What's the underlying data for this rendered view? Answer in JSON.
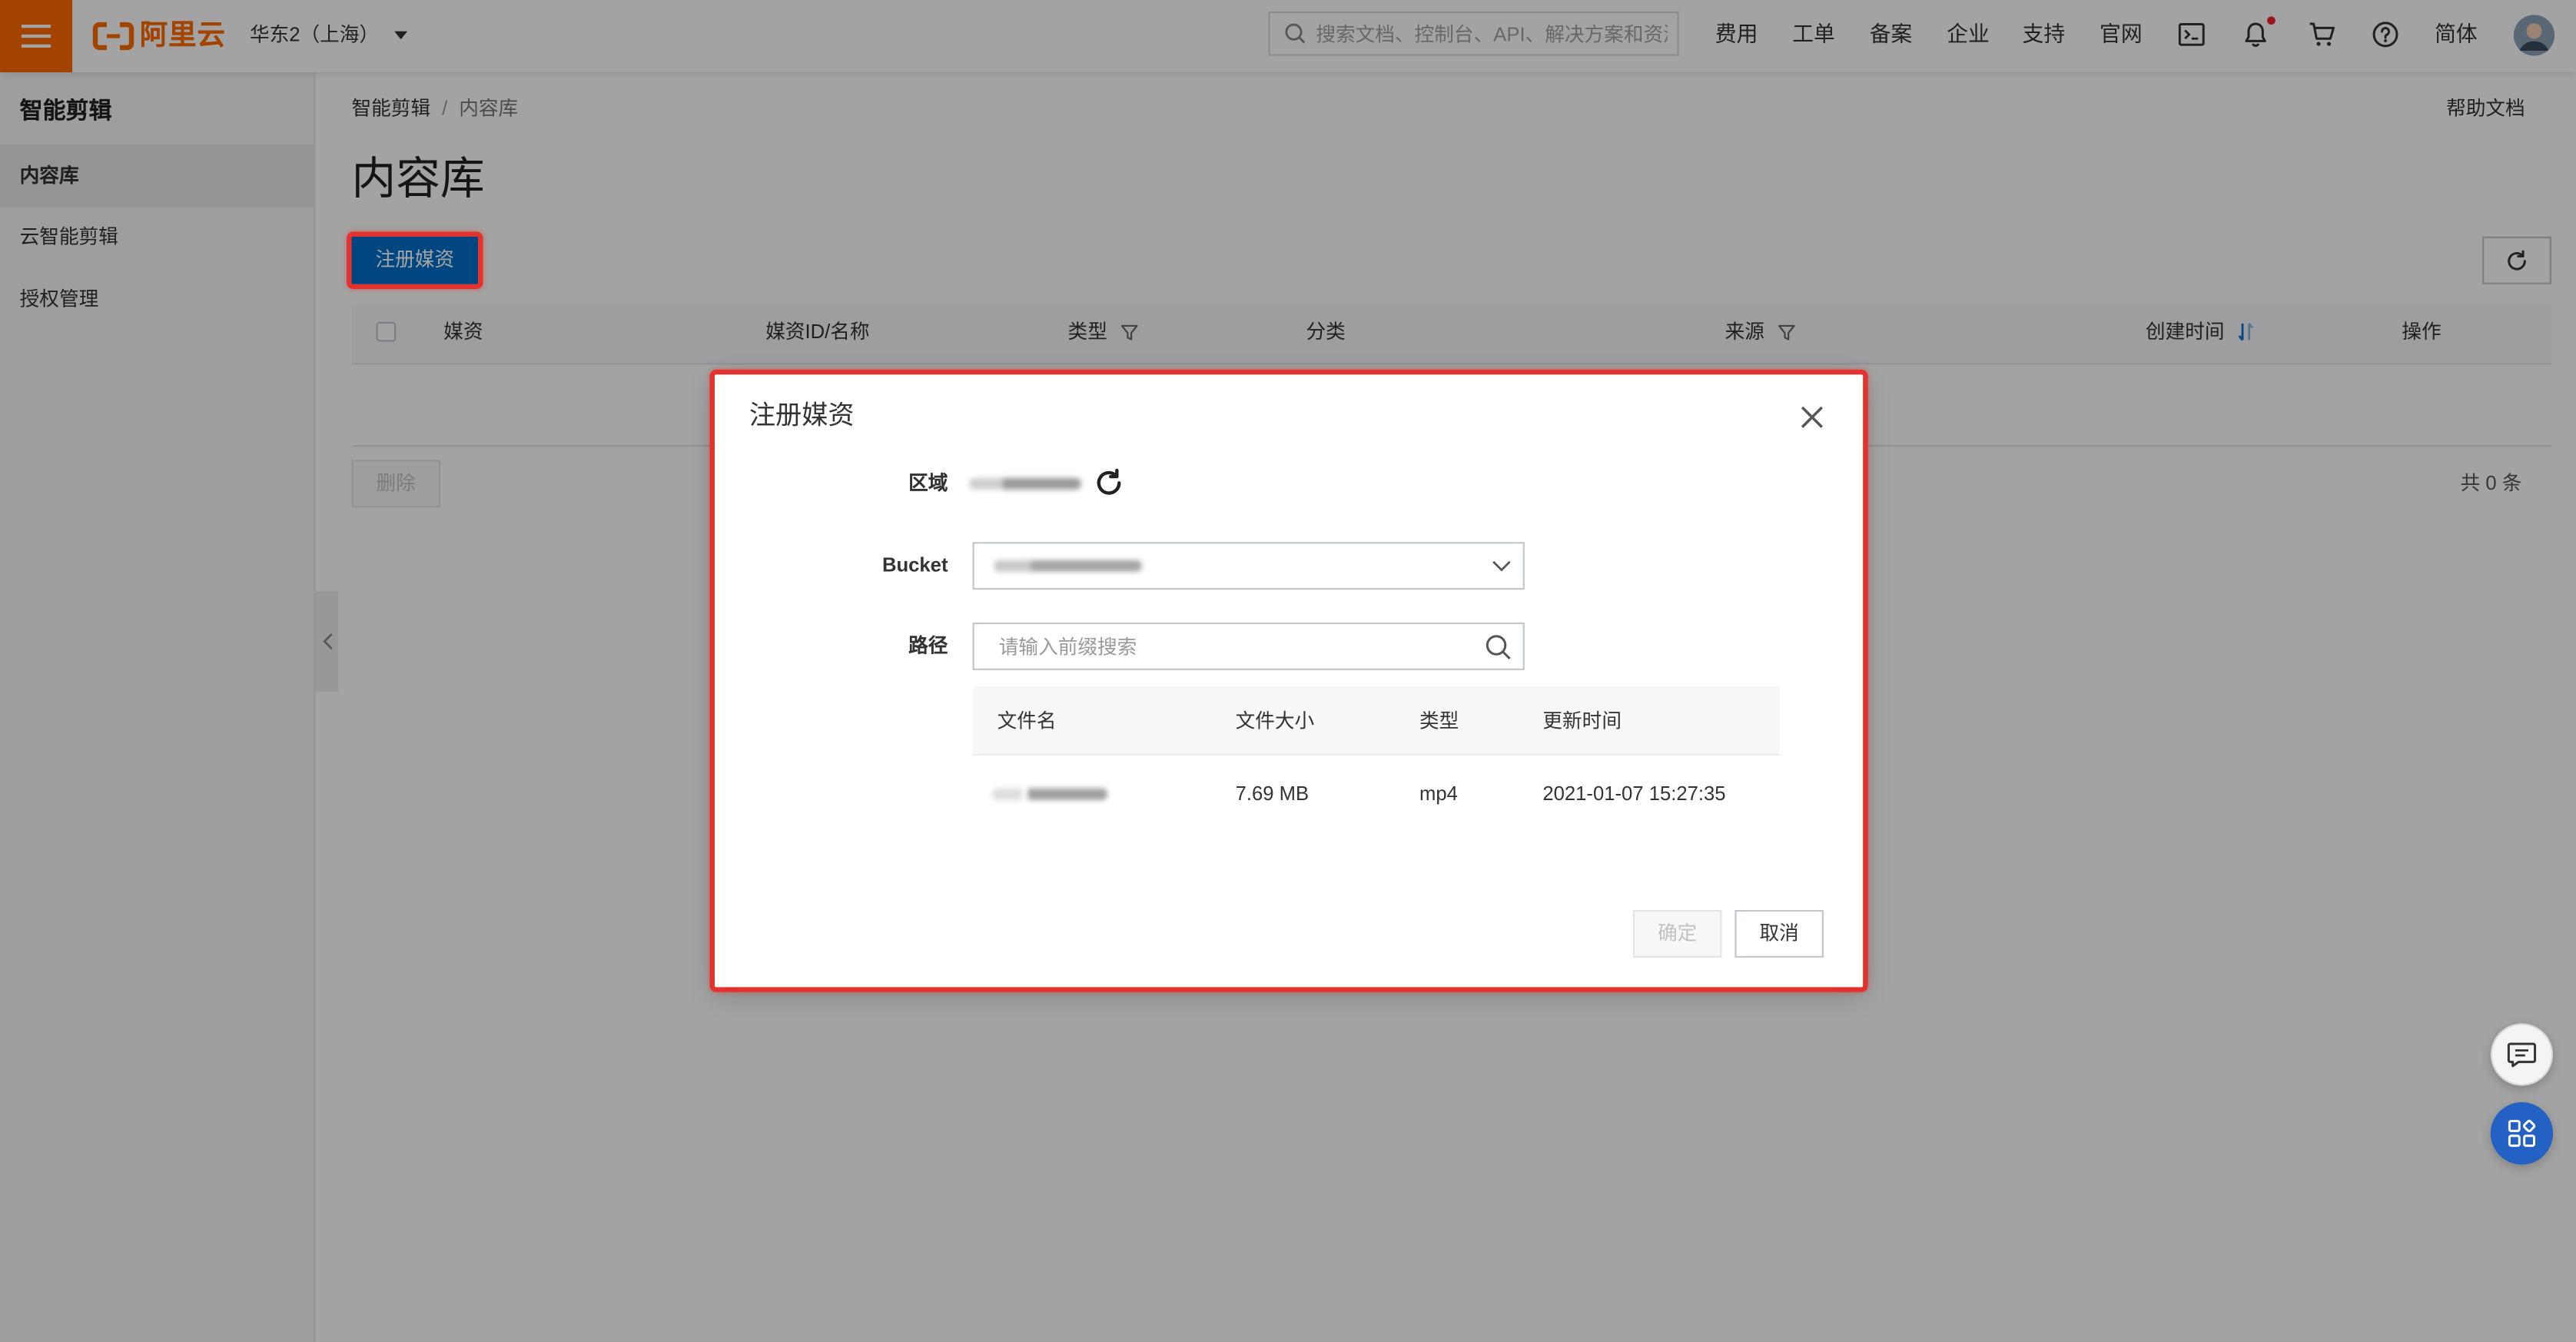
{
  "topbar": {
    "logo_text": "阿里云",
    "region": "华东2（上海）",
    "search_placeholder": "搜索文档、控制台、API、解决方案和资源",
    "nav": [
      "费用",
      "工单",
      "备案",
      "企业",
      "支持",
      "官网"
    ],
    "language": "简体",
    "icons": [
      "hamburger-menu-icon",
      "aliyun-logo-icon",
      "caret-down-icon",
      "search-icon",
      "terminal-icon",
      "bell-icon",
      "cart-icon",
      "help-icon",
      "avatar"
    ],
    "has_notification": true
  },
  "sidebar": {
    "title": "智能剪辑",
    "items": [
      {
        "label": "内容库",
        "active": true
      },
      {
        "label": "云智能剪辑",
        "active": false
      },
      {
        "label": "授权管理",
        "active": false
      }
    ]
  },
  "main": {
    "breadcrumb": [
      "智能剪辑",
      "内容库"
    ],
    "breadcrumb_separator": "/",
    "help_link": "帮助文档",
    "title": "内容库",
    "register_button": "注册媒资",
    "table": {
      "columns": [
        "媒资",
        "媒资ID/名称",
        "类型",
        "分类",
        "来源",
        "创建时间",
        "操作"
      ],
      "rows": []
    },
    "delete_button": "删除",
    "delete_enabled": false,
    "total": "共 0 条"
  },
  "dialog": {
    "title": "注册媒资",
    "region_label": "区域",
    "bucket_label": "Bucket",
    "path_label": "路径",
    "path_placeholder": "请输入前缀搜索",
    "file_table": {
      "columns": [
        "文件名",
        "文件大小",
        "类型",
        "更新时间"
      ],
      "rows": [
        {
          "size": "7.69 MB",
          "type": "mp4",
          "updated": "2021-01-07 15:27:35"
        }
      ]
    },
    "ok_button": "确定",
    "ok_enabled": false,
    "cancel_button": "取消"
  },
  "colors": {
    "brand_orange": "#ff6a00",
    "primary_blue": "#0070cc",
    "annotation_red": "#e5322d",
    "notification_dot": "#f5222d",
    "float_button_blue": "#2361c4"
  }
}
